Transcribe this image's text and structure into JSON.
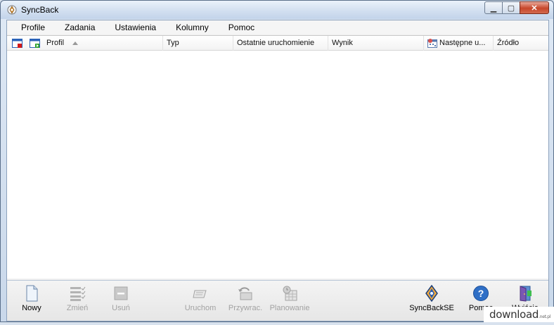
{
  "window": {
    "title": "SyncBack"
  },
  "menu": [
    "Profile",
    "Zadania",
    "Ustawienia",
    "Kolumny",
    "Pomoc"
  ],
  "list": {
    "columns": [
      {
        "label": "Profil",
        "sorted": "ascending"
      },
      {
        "label": "Typ"
      },
      {
        "label": "Ostatnie uruchomienie"
      },
      {
        "label": "Wynik"
      },
      {
        "label": "Następne u..."
      },
      {
        "label": "Źródło"
      }
    ],
    "rows": []
  },
  "toolbar": {
    "buttons": [
      {
        "label": "Nowy",
        "enabled": true,
        "icon": "new-document-icon"
      },
      {
        "label": "Zmień",
        "enabled": false,
        "icon": "modify-list-icon"
      },
      {
        "label": "Usuń",
        "enabled": false,
        "icon": "delete-icon"
      },
      {
        "label": "Uruchom",
        "enabled": false,
        "icon": "run-icon"
      },
      {
        "label": "Przywrac.",
        "enabled": false,
        "icon": "restore-icon"
      },
      {
        "label": "Planowanie",
        "enabled": false,
        "icon": "schedule-icon"
      },
      {
        "label": "SyncBackSE",
        "enabled": true,
        "icon": "syncbackse-icon"
      },
      {
        "label": "Pomoc",
        "enabled": true,
        "icon": "help-icon"
      },
      {
        "label": "Wyjście",
        "enabled": true,
        "icon": "exit-door-icon"
      }
    ]
  },
  "watermark": {
    "text": "download",
    "suffix": ".net.pl"
  },
  "colors": {
    "titlebar": "#d4e1f1",
    "close_button": "#c7462a",
    "help_icon": "#2f6fc6"
  }
}
